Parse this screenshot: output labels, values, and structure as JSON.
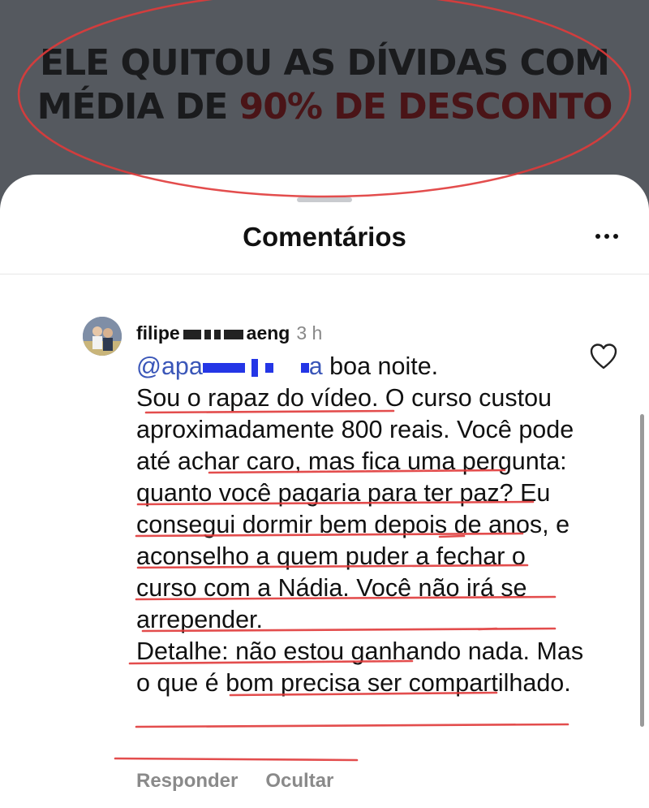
{
  "video": {
    "headline_line1": "ELE QUITOU AS DÍVIDAS COM",
    "headline_line2_prefix": "MÉDIA DE ",
    "headline_line2_accent": "90% DE DESCONTO"
  },
  "sheet": {
    "title": "Comentários",
    "more_icon": "more-horizontal-icon"
  },
  "comment": {
    "username": "filipe",
    "username_suffix": "aeng",
    "time": "3 h",
    "mention_prefix": "@apa",
    "mention_suffix": "a",
    "greeting": " boa noite.",
    "paragraph1": "Sou o rapaz do vídeo. O curso custou aproximadamente 800 reais. Você pode até achar caro, mas fica uma pergunta: quanto você pagaria para ter paz? Eu consegui dormir bem depois de anos, e aconselho a quem puder a fechar o curso com a Nádia. Você não irá se arrepender.",
    "paragraph2": "Detalhe: não estou ganhando nada. Mas o que é bom precisa ser compartilhado.",
    "like_icon": "heart-outline-icon"
  },
  "actions": {
    "reply_label": "Responder",
    "hide_label": "Ocultar"
  },
  "colors": {
    "annotation_red": "#e03a3a",
    "mention_blue": "#3a56b8"
  }
}
